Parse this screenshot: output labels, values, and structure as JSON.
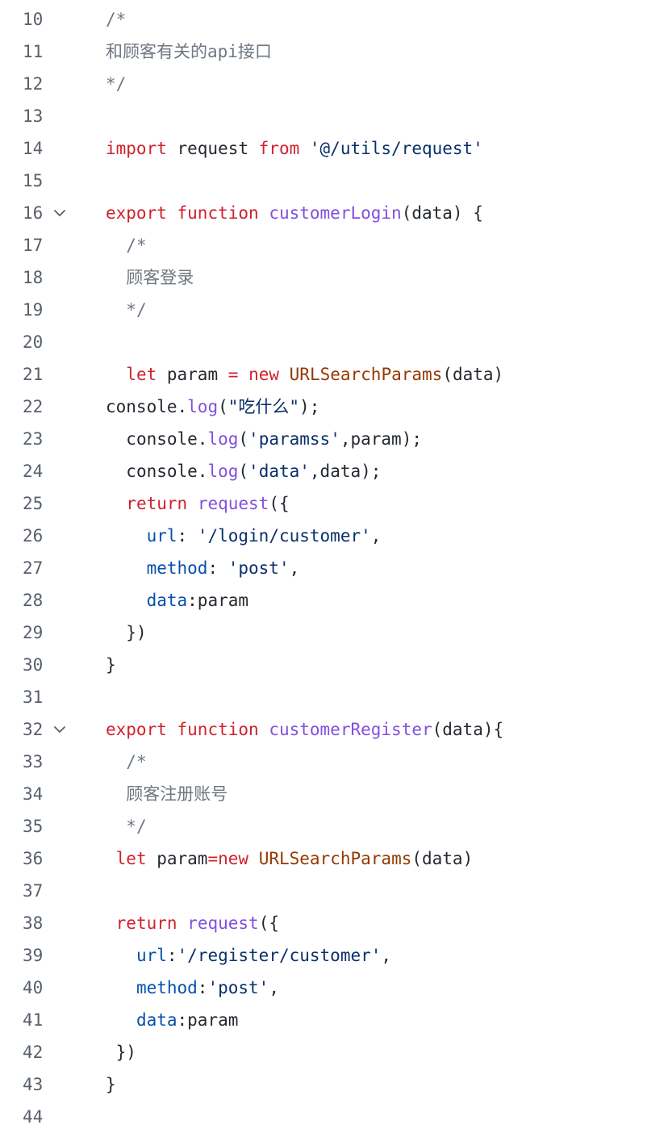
{
  "editor": {
    "lines": [
      {
        "num": "10",
        "indent": "",
        "tokens": [
          {
            "t": "/*",
            "c": "cmt"
          }
        ]
      },
      {
        "num": "11",
        "indent": "",
        "tokens": [
          {
            "t": "和顾客有关的api接口",
            "c": "cmt"
          }
        ]
      },
      {
        "num": "12",
        "indent": "",
        "tokens": [
          {
            "t": "*/",
            "c": "cmt"
          }
        ]
      },
      {
        "num": "13",
        "indent": "",
        "tokens": []
      },
      {
        "num": "14",
        "indent": "",
        "tokens": [
          {
            "t": "import",
            "c": "kw"
          },
          {
            "t": " request ",
            "c": "plain"
          },
          {
            "t": "from",
            "c": "kw"
          },
          {
            "t": " ",
            "c": "plain"
          },
          {
            "t": "'@/utils/request'",
            "c": "str"
          }
        ]
      },
      {
        "num": "15",
        "indent": "",
        "tokens": []
      },
      {
        "num": "16",
        "indent": "",
        "fold": true,
        "tokens": [
          {
            "t": "export",
            "c": "kw"
          },
          {
            "t": " ",
            "c": "plain"
          },
          {
            "t": "function",
            "c": "kw"
          },
          {
            "t": " ",
            "c": "plain"
          },
          {
            "t": "customerLogin",
            "c": "fn"
          },
          {
            "t": "(data) {",
            "c": "plain"
          }
        ]
      },
      {
        "num": "17",
        "indent": "  ",
        "tokens": [
          {
            "t": "/*",
            "c": "cmt"
          }
        ]
      },
      {
        "num": "18",
        "indent": "  ",
        "tokens": [
          {
            "t": "顾客登录",
            "c": "cmt"
          }
        ]
      },
      {
        "num": "19",
        "indent": "  ",
        "tokens": [
          {
            "t": "*/",
            "c": "cmt"
          }
        ]
      },
      {
        "num": "20",
        "indent": "",
        "tokens": []
      },
      {
        "num": "21",
        "indent": "  ",
        "tokens": [
          {
            "t": "let",
            "c": "kw"
          },
          {
            "t": " param ",
            "c": "plain"
          },
          {
            "t": "=",
            "c": "kw"
          },
          {
            "t": " ",
            "c": "plain"
          },
          {
            "t": "new",
            "c": "kw"
          },
          {
            "t": " ",
            "c": "plain"
          },
          {
            "t": "URLSearchParams",
            "c": "cls"
          },
          {
            "t": "(data)",
            "c": "plain"
          }
        ]
      },
      {
        "num": "22",
        "indent": "",
        "tokens": [
          {
            "t": "console.",
            "c": "plain"
          },
          {
            "t": "log",
            "c": "fn"
          },
          {
            "t": "(",
            "c": "plain"
          },
          {
            "t": "\"吃什么\"",
            "c": "str"
          },
          {
            "t": ");",
            "c": "plain"
          }
        ]
      },
      {
        "num": "23",
        "indent": "  ",
        "tokens": [
          {
            "t": "console.",
            "c": "plain"
          },
          {
            "t": "log",
            "c": "fn"
          },
          {
            "t": "(",
            "c": "plain"
          },
          {
            "t": "'paramss'",
            "c": "str"
          },
          {
            "t": ",param);",
            "c": "plain"
          }
        ]
      },
      {
        "num": "24",
        "indent": "  ",
        "tokens": [
          {
            "t": "console.",
            "c": "plain"
          },
          {
            "t": "log",
            "c": "fn"
          },
          {
            "t": "(",
            "c": "plain"
          },
          {
            "t": "'data'",
            "c": "str"
          },
          {
            "t": ",data);",
            "c": "plain"
          }
        ]
      },
      {
        "num": "25",
        "indent": "  ",
        "tokens": [
          {
            "t": "return",
            "c": "kw"
          },
          {
            "t": " ",
            "c": "plain"
          },
          {
            "t": "request",
            "c": "fn"
          },
          {
            "t": "({",
            "c": "plain"
          }
        ]
      },
      {
        "num": "26",
        "indent": "    ",
        "tokens": [
          {
            "t": "url",
            "c": "prop"
          },
          {
            "t": ": ",
            "c": "plain"
          },
          {
            "t": "'/login/customer'",
            "c": "str"
          },
          {
            "t": ",",
            "c": "plain"
          }
        ]
      },
      {
        "num": "27",
        "indent": "    ",
        "tokens": [
          {
            "t": "method",
            "c": "prop"
          },
          {
            "t": ": ",
            "c": "plain"
          },
          {
            "t": "'post'",
            "c": "str"
          },
          {
            "t": ",",
            "c": "plain"
          }
        ]
      },
      {
        "num": "28",
        "indent": "    ",
        "tokens": [
          {
            "t": "data",
            "c": "prop"
          },
          {
            "t": ":param",
            "c": "plain"
          }
        ]
      },
      {
        "num": "29",
        "indent": "  ",
        "tokens": [
          {
            "t": "})",
            "c": "plain"
          }
        ]
      },
      {
        "num": "30",
        "indent": "",
        "tokens": [
          {
            "t": "}",
            "c": "plain"
          }
        ]
      },
      {
        "num": "31",
        "indent": "",
        "tokens": []
      },
      {
        "num": "32",
        "indent": "",
        "fold": true,
        "tokens": [
          {
            "t": "export",
            "c": "kw"
          },
          {
            "t": " ",
            "c": "plain"
          },
          {
            "t": "function",
            "c": "kw"
          },
          {
            "t": " ",
            "c": "plain"
          },
          {
            "t": "customerRegister",
            "c": "fn"
          },
          {
            "t": "(data){",
            "c": "plain"
          }
        ]
      },
      {
        "num": "33",
        "indent": "  ",
        "tokens": [
          {
            "t": "/*",
            "c": "cmt"
          }
        ]
      },
      {
        "num": "34",
        "indent": "  ",
        "tokens": [
          {
            "t": "顾客注册账号",
            "c": "cmt"
          }
        ]
      },
      {
        "num": "35",
        "indent": "  ",
        "tokens": [
          {
            "t": "*/",
            "c": "cmt"
          }
        ]
      },
      {
        "num": "36",
        "indent": " ",
        "tokens": [
          {
            "t": "let",
            "c": "kw"
          },
          {
            "t": " param",
            "c": "plain"
          },
          {
            "t": "=",
            "c": "kw"
          },
          {
            "t": "new",
            "c": "kw"
          },
          {
            "t": " ",
            "c": "plain"
          },
          {
            "t": "URLSearchParams",
            "c": "cls"
          },
          {
            "t": "(data)",
            "c": "plain"
          }
        ]
      },
      {
        "num": "37",
        "indent": "",
        "tokens": []
      },
      {
        "num": "38",
        "indent": " ",
        "tokens": [
          {
            "t": "return",
            "c": "kw"
          },
          {
            "t": " ",
            "c": "plain"
          },
          {
            "t": "request",
            "c": "fn"
          },
          {
            "t": "({",
            "c": "plain"
          }
        ]
      },
      {
        "num": "39",
        "indent": "   ",
        "tokens": [
          {
            "t": "url",
            "c": "prop"
          },
          {
            "t": ":",
            "c": "plain"
          },
          {
            "t": "'/register/customer'",
            "c": "str"
          },
          {
            "t": ",",
            "c": "plain"
          }
        ]
      },
      {
        "num": "40",
        "indent": "   ",
        "tokens": [
          {
            "t": "method",
            "c": "prop"
          },
          {
            "t": ":",
            "c": "plain"
          },
          {
            "t": "'post'",
            "c": "str"
          },
          {
            "t": ",",
            "c": "plain"
          }
        ]
      },
      {
        "num": "41",
        "indent": "   ",
        "tokens": [
          {
            "t": "data",
            "c": "prop"
          },
          {
            "t": ":param",
            "c": "plain"
          }
        ]
      },
      {
        "num": "42",
        "indent": " ",
        "tokens": [
          {
            "t": "})",
            "c": "plain"
          }
        ]
      },
      {
        "num": "43",
        "indent": "",
        "tokens": [
          {
            "t": "}",
            "c": "plain"
          }
        ]
      },
      {
        "num": "44",
        "indent": "",
        "tokens": []
      }
    ],
    "fold_icon": "chevron-down-icon",
    "colors": {
      "keyword": "#cf222e",
      "function": "#8250df",
      "string": "#0a3069",
      "property": "#0550ae",
      "class": "#953800",
      "comment": "#6e7781",
      "text": "#24292f",
      "line_number": "#57606a"
    }
  }
}
